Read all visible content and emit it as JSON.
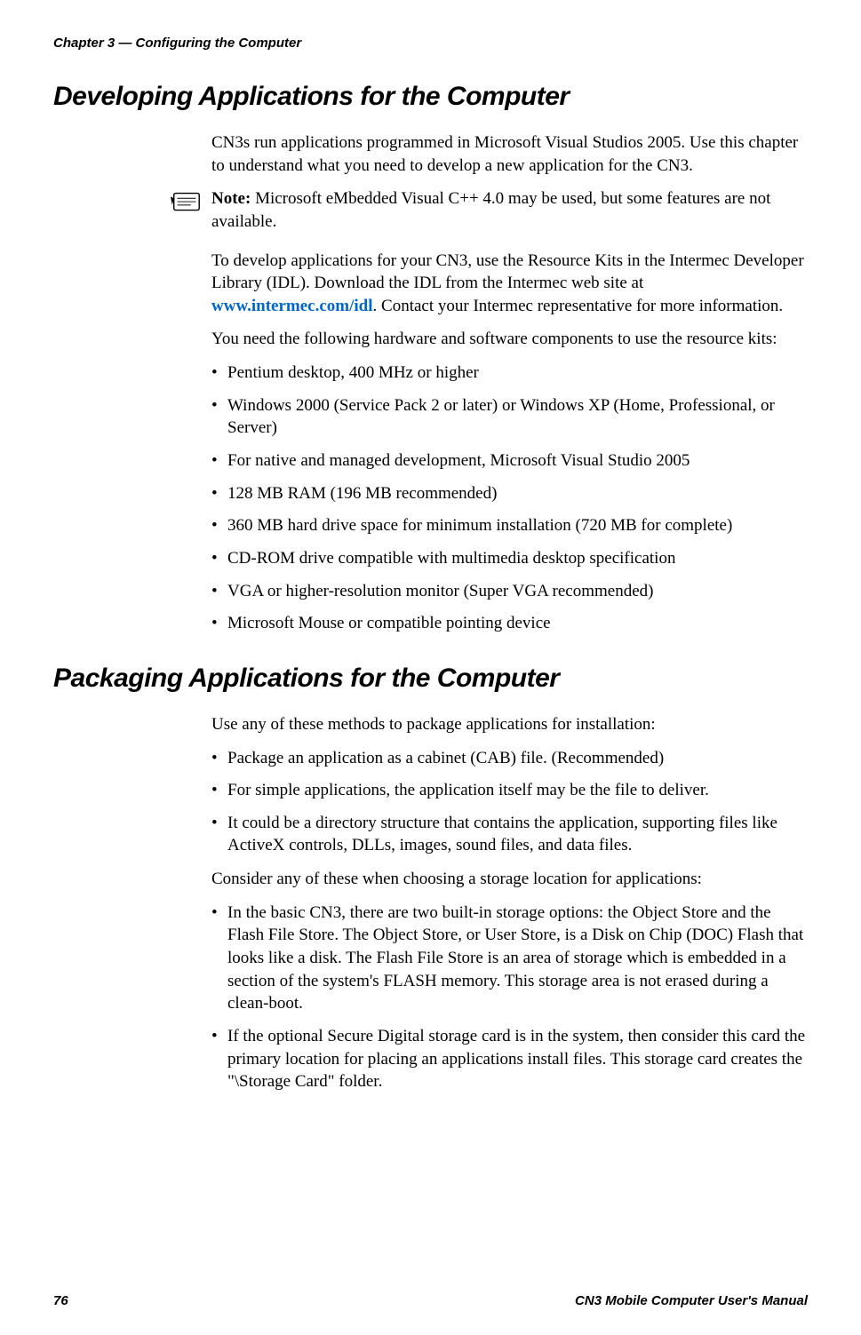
{
  "header": "Chapter 3 — Configuring the Computer",
  "section1": {
    "heading": "Developing Applications for the Computer",
    "intro": "CN3s run applications programmed in Microsoft Visual Studios 2005. Use this chapter to understand what you need to develop a new application for the CN3.",
    "note_label": "Note:",
    "note_text": " Microsoft eMbedded Visual C++ 4.0 may be used, but some features are not available.",
    "para1_a": "To develop applications for your CN3, use the Resource Kits in the Intermec Developer Library (IDL). Download the IDL from the Intermec web site at ",
    "para1_link": "www.intermec.com/idl",
    "para1_b": ". Contact your Intermec representative for more information.",
    "para2": "You need the following hardware and software components to use the resource kits:",
    "bullets": [
      "Pentium desktop, 400 MHz or higher",
      "Windows 2000 (Service Pack 2 or later) or Windows XP (Home, Professional, or Server)",
      "For native and managed development, Microsoft Visual Studio 2005",
      "128 MB RAM (196 MB recommended)",
      "360 MB hard drive space for minimum installation (720 MB for complete)",
      "CD-ROM drive compatible with multimedia desktop specification",
      "VGA or higher-resolution monitor (Super VGA recommended)",
      "Microsoft Mouse or compatible pointing device"
    ]
  },
  "section2": {
    "heading": "Packaging Applications for the Computer",
    "intro": "Use any of these methods to package applications for installation:",
    "bullets1": [
      "Package an application as a cabinet (CAB) file. (Recommended)",
      "For simple applications, the application itself may be the file to deliver.",
      "It could be a directory structure that contains the application, supporting files like ActiveX controls, DLLs, images, sound files, and data files."
    ],
    "para2": "Consider any of these when choosing a storage location for applications:",
    "bullets2": [
      "In the basic CN3, there are two built-in storage options: the Object Store and the Flash File Store. The Object Store, or User Store, is a Disk on Chip (DOC) Flash that looks like a disk. The Flash File Store is an area of storage which is embedded in a section of the system's FLASH memory. This storage area is not erased during a clean-boot.",
      "If the optional Secure Digital storage card is in the system, then consider this card the primary location for placing an applications install files. This storage card creates the \"\\Storage Card\" folder."
    ]
  },
  "footer": {
    "page": "76",
    "title": "CN3 Mobile Computer User's Manual"
  }
}
